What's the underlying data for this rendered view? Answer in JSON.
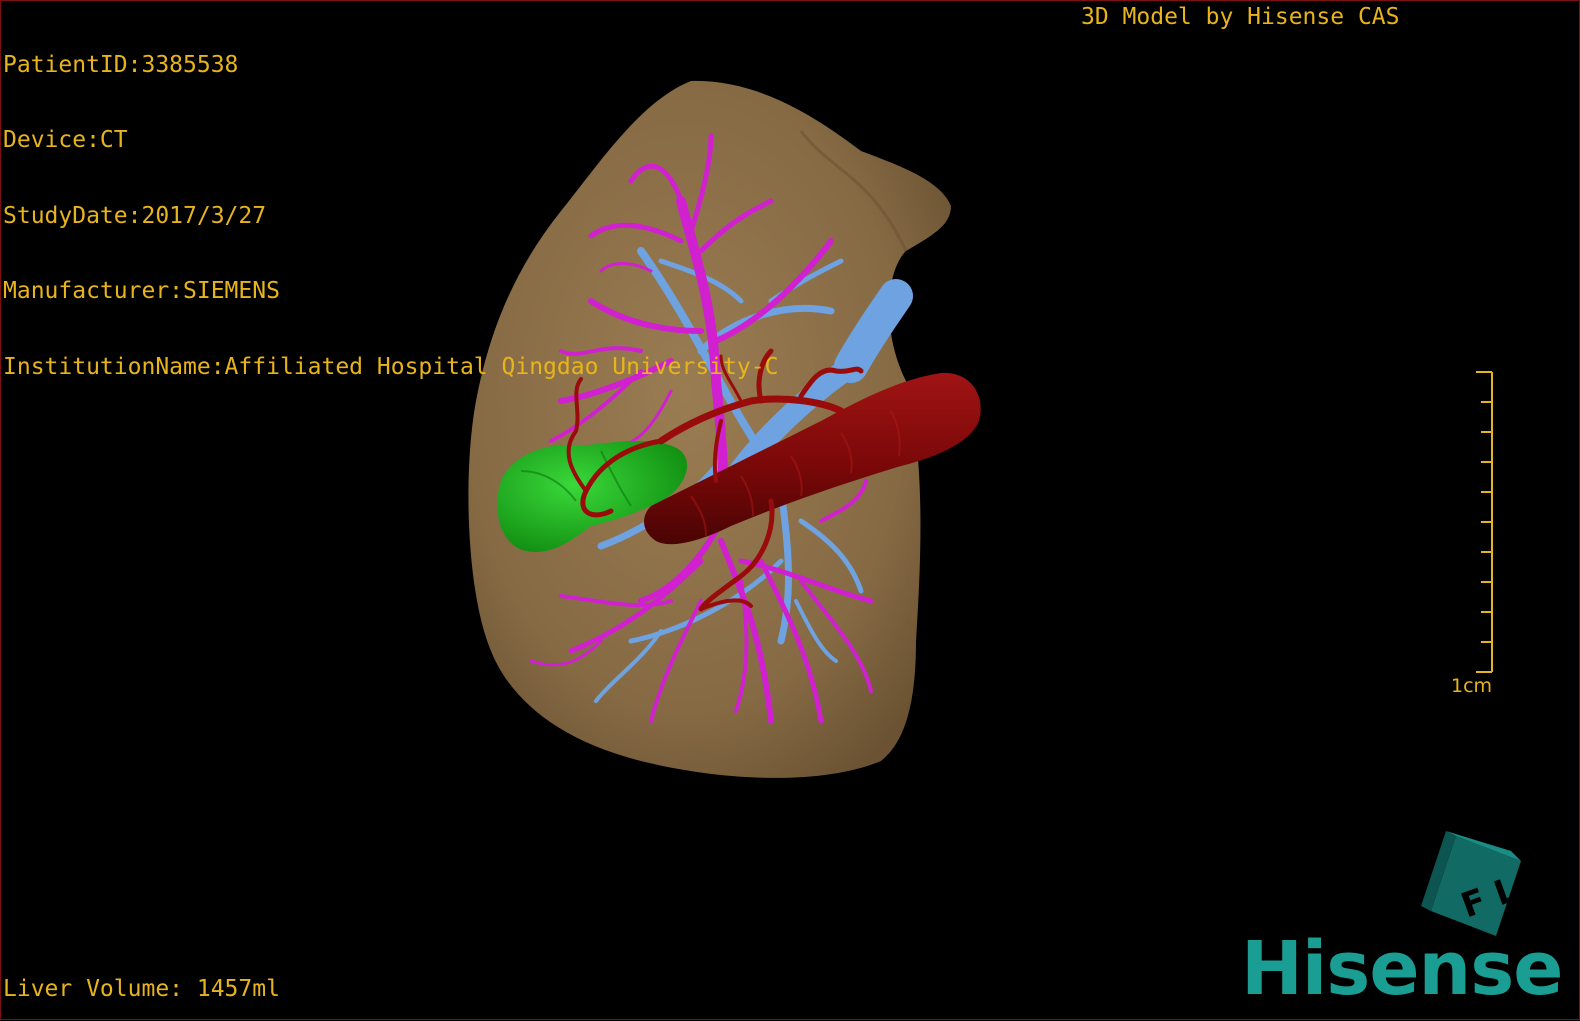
{
  "overlay": {
    "patient_id": "PatientID:3385538",
    "device": "Device:CT",
    "study_date": "StudyDate:2017/3/27",
    "manufacturer": "Manufacturer:SIEMENS",
    "institution": "InstitutionName:Affiliated Hospital Qingdao University-C",
    "brand_line": "3D Model by Hisense CAS",
    "liver_volume": "Liver Volume: 1457ml",
    "scale_label": "1cm"
  },
  "logo": {
    "cube_text": "F L",
    "name": "Hisense"
  },
  "colors": {
    "overlay_text": "#e8b41c",
    "liver": "#8b7048",
    "hepatic_vein": "#d020d0",
    "portal_vein": "#6ea2e0",
    "artery": "#8b0a0a",
    "gallbladder": "#1fb81f",
    "logo": "#1a9e93"
  }
}
